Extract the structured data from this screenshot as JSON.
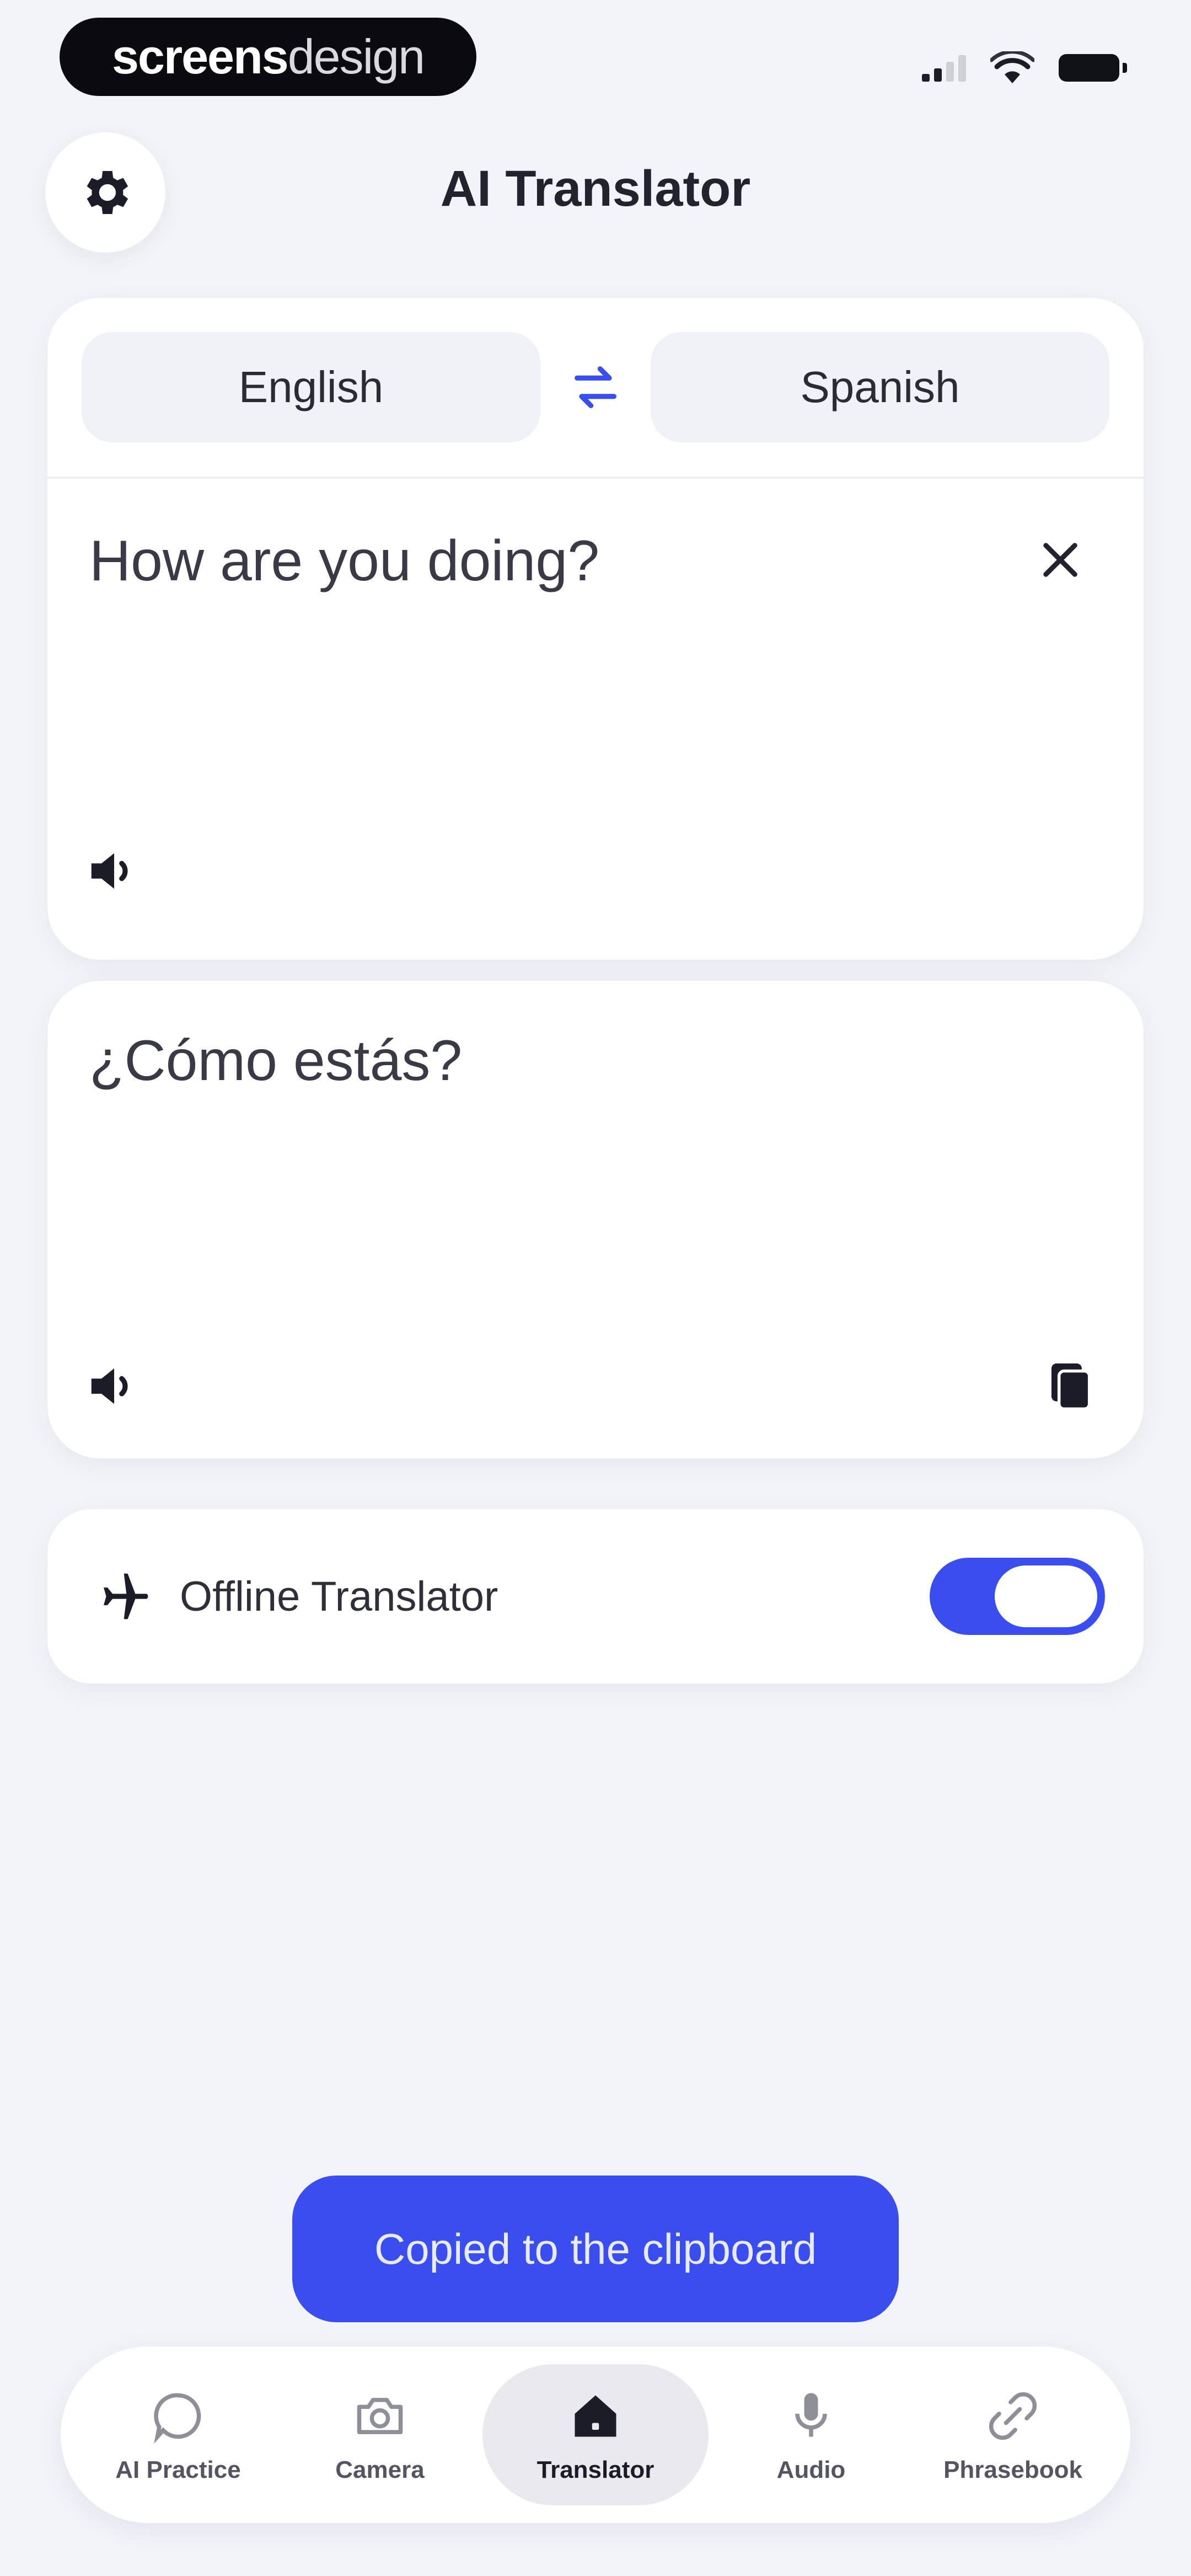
{
  "status_bar": {
    "brand_bold": "screens",
    "brand_light": "design"
  },
  "header": {
    "title": "AI Translator",
    "settings_icon": "gear-icon"
  },
  "translator": {
    "source_language": "English",
    "target_language": "Spanish",
    "source_text": "How are you doing?",
    "translated_text": "¿Cómo estás?",
    "accent_color": "#3a4ef0"
  },
  "offline": {
    "label": "Offline Translator",
    "enabled": true
  },
  "toast": {
    "message": "Copied to the clipboard"
  },
  "bottom_nav": {
    "items": [
      {
        "label": "AI Practice",
        "icon": "chat-bubble-icon"
      },
      {
        "label": "Camera",
        "icon": "camera-icon"
      },
      {
        "label": "Translator",
        "icon": "home-icon",
        "active": true
      },
      {
        "label": "Audio",
        "icon": "microphone-icon"
      },
      {
        "label": "Phrasebook",
        "icon": "phrasebook-icon"
      }
    ]
  }
}
